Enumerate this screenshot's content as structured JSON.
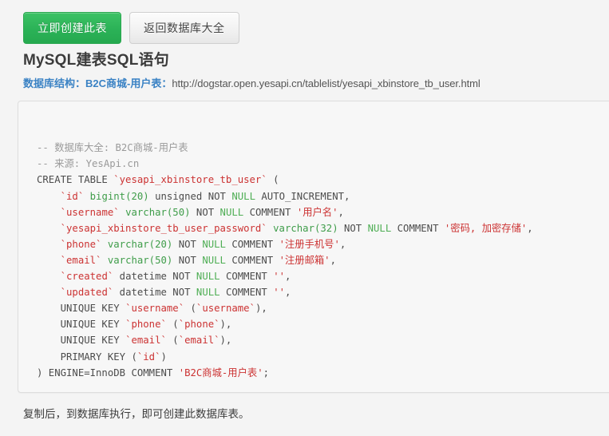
{
  "toolbar": {
    "create_label": "立即创建此表",
    "back_label": "返回数据库大全",
    "primary_color": "#2bb257",
    "default_color": "#f1f1f1"
  },
  "heading": {
    "title": "MySQL建表SQL语句"
  },
  "subtitle": {
    "label": "数据库结构：",
    "table_name": "B2C商城-用户表",
    "separator": "：",
    "url": "http://dogstar.open.yesapi.cn/tablelist/yesapi_xbinstore_tb_user.html",
    "link_color": "#3a82c4"
  },
  "code": {
    "language": "sql",
    "lines": [
      [
        {
          "t": "-- 数据库大全: B2C商城-用户表",
          "c": "c-comment"
        }
      ],
      [
        {
          "t": "-- 来源: YesApi.cn",
          "c": "c-comment"
        }
      ],
      [
        {
          "t": "CREATE TABLE ",
          "c": "c-kw"
        },
        {
          "t": "`yesapi_xbinstore_tb_user`",
          "c": "c-ident"
        },
        {
          "t": " (",
          "c": "c-punc"
        }
      ],
      [
        {
          "t": "    ",
          "c": "c-punc"
        },
        {
          "t": "`id`",
          "c": "c-ident"
        },
        {
          "t": " ",
          "c": "c-punc"
        },
        {
          "t": "bigint(20)",
          "c": "c-type"
        },
        {
          "t": " unsigned NOT ",
          "c": "c-kw"
        },
        {
          "t": "NULL",
          "c": "c-null"
        },
        {
          "t": " AUTO_INCREMENT,",
          "c": "c-kw"
        }
      ],
      [
        {
          "t": "    ",
          "c": "c-punc"
        },
        {
          "t": "`username`",
          "c": "c-ident"
        },
        {
          "t": " ",
          "c": "c-punc"
        },
        {
          "t": "varchar(50)",
          "c": "c-type"
        },
        {
          "t": " NOT ",
          "c": "c-kw"
        },
        {
          "t": "NULL",
          "c": "c-null"
        },
        {
          "t": " COMMENT ",
          "c": "c-kw"
        },
        {
          "t": "'用户名'",
          "c": "c-str"
        },
        {
          "t": ",",
          "c": "c-punc"
        }
      ],
      [
        {
          "t": "    ",
          "c": "c-punc"
        },
        {
          "t": "`yesapi_xbinstore_tb_user_password`",
          "c": "c-ident"
        },
        {
          "t": " ",
          "c": "c-punc"
        },
        {
          "t": "varchar(32)",
          "c": "c-type"
        },
        {
          "t": " NOT ",
          "c": "c-kw"
        },
        {
          "t": "NULL",
          "c": "c-null"
        },
        {
          "t": " COMMENT ",
          "c": "c-kw"
        },
        {
          "t": "'密码, 加密存储'",
          "c": "c-str"
        },
        {
          "t": ",",
          "c": "c-punc"
        }
      ],
      [
        {
          "t": "    ",
          "c": "c-punc"
        },
        {
          "t": "`phone`",
          "c": "c-ident"
        },
        {
          "t": " ",
          "c": "c-punc"
        },
        {
          "t": "varchar(20)",
          "c": "c-type"
        },
        {
          "t": " NOT ",
          "c": "c-kw"
        },
        {
          "t": "NULL",
          "c": "c-null"
        },
        {
          "t": " COMMENT ",
          "c": "c-kw"
        },
        {
          "t": "'注册手机号'",
          "c": "c-str"
        },
        {
          "t": ",",
          "c": "c-punc"
        }
      ],
      [
        {
          "t": "    ",
          "c": "c-punc"
        },
        {
          "t": "`email`",
          "c": "c-ident"
        },
        {
          "t": " ",
          "c": "c-punc"
        },
        {
          "t": "varchar(50)",
          "c": "c-type"
        },
        {
          "t": " NOT ",
          "c": "c-kw"
        },
        {
          "t": "NULL",
          "c": "c-null"
        },
        {
          "t": " COMMENT ",
          "c": "c-kw"
        },
        {
          "t": "'注册邮箱'",
          "c": "c-str"
        },
        {
          "t": ",",
          "c": "c-punc"
        }
      ],
      [
        {
          "t": "    ",
          "c": "c-punc"
        },
        {
          "t": "`created`",
          "c": "c-ident"
        },
        {
          "t": " datetime NOT ",
          "c": "c-kw"
        },
        {
          "t": "NULL",
          "c": "c-null"
        },
        {
          "t": " COMMENT ",
          "c": "c-kw"
        },
        {
          "t": "''",
          "c": "c-str"
        },
        {
          "t": ",",
          "c": "c-punc"
        }
      ],
      [
        {
          "t": "    ",
          "c": "c-punc"
        },
        {
          "t": "`updated`",
          "c": "c-ident"
        },
        {
          "t": " datetime NOT ",
          "c": "c-kw"
        },
        {
          "t": "NULL",
          "c": "c-null"
        },
        {
          "t": " COMMENT ",
          "c": "c-kw"
        },
        {
          "t": "''",
          "c": "c-str"
        },
        {
          "t": ",",
          "c": "c-punc"
        }
      ],
      [
        {
          "t": "    UNIQUE KEY ",
          "c": "c-kw"
        },
        {
          "t": "`username`",
          "c": "c-ident"
        },
        {
          "t": " (",
          "c": "c-punc"
        },
        {
          "t": "`username`",
          "c": "c-ident"
        },
        {
          "t": "),",
          "c": "c-punc"
        }
      ],
      [
        {
          "t": "    UNIQUE KEY ",
          "c": "c-kw"
        },
        {
          "t": "`phone`",
          "c": "c-ident"
        },
        {
          "t": " (",
          "c": "c-punc"
        },
        {
          "t": "`phone`",
          "c": "c-ident"
        },
        {
          "t": "),",
          "c": "c-punc"
        }
      ],
      [
        {
          "t": "    UNIQUE KEY ",
          "c": "c-kw"
        },
        {
          "t": "`email`",
          "c": "c-ident"
        },
        {
          "t": " (",
          "c": "c-punc"
        },
        {
          "t": "`email`",
          "c": "c-ident"
        },
        {
          "t": "),",
          "c": "c-punc"
        }
      ],
      [
        {
          "t": "    PRIMARY KEY (",
          "c": "c-kw"
        },
        {
          "t": "`id`",
          "c": "c-ident"
        },
        {
          "t": ")",
          "c": "c-punc"
        }
      ],
      [
        {
          "t": ") ENGINE=InnoDB COMMENT ",
          "c": "c-kw"
        },
        {
          "t": "'B2C商城-用户表'",
          "c": "c-str"
        },
        {
          "t": ";",
          "c": "c-punc"
        }
      ]
    ]
  },
  "footer": {
    "note": "复制后，到数据库执行，即可创建此数据库表。"
  }
}
